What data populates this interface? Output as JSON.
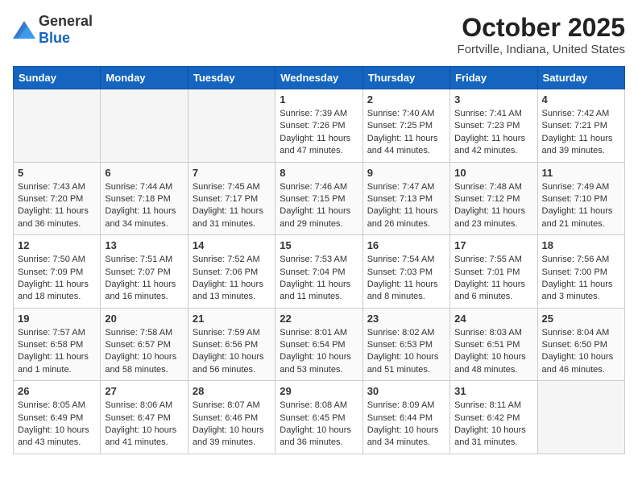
{
  "header": {
    "logo_general": "General",
    "logo_blue": "Blue",
    "month_year": "October 2025",
    "location": "Fortville, Indiana, United States"
  },
  "weekdays": [
    "Sunday",
    "Monday",
    "Tuesday",
    "Wednesday",
    "Thursday",
    "Friday",
    "Saturday"
  ],
  "weeks": [
    [
      {
        "day": "",
        "empty": true
      },
      {
        "day": "",
        "empty": true
      },
      {
        "day": "",
        "empty": true
      },
      {
        "day": "1",
        "sunrise": "7:39 AM",
        "sunset": "7:26 PM",
        "daylight": "11 hours and 47 minutes."
      },
      {
        "day": "2",
        "sunrise": "7:40 AM",
        "sunset": "7:25 PM",
        "daylight": "11 hours and 44 minutes."
      },
      {
        "day": "3",
        "sunrise": "7:41 AM",
        "sunset": "7:23 PM",
        "daylight": "11 hours and 42 minutes."
      },
      {
        "day": "4",
        "sunrise": "7:42 AM",
        "sunset": "7:21 PM",
        "daylight": "11 hours and 39 minutes."
      }
    ],
    [
      {
        "day": "5",
        "sunrise": "7:43 AM",
        "sunset": "7:20 PM",
        "daylight": "11 hours and 36 minutes."
      },
      {
        "day": "6",
        "sunrise": "7:44 AM",
        "sunset": "7:18 PM",
        "daylight": "11 hours and 34 minutes."
      },
      {
        "day": "7",
        "sunrise": "7:45 AM",
        "sunset": "7:17 PM",
        "daylight": "11 hours and 31 minutes."
      },
      {
        "day": "8",
        "sunrise": "7:46 AM",
        "sunset": "7:15 PM",
        "daylight": "11 hours and 29 minutes."
      },
      {
        "day": "9",
        "sunrise": "7:47 AM",
        "sunset": "7:13 PM",
        "daylight": "11 hours and 26 minutes."
      },
      {
        "day": "10",
        "sunrise": "7:48 AM",
        "sunset": "7:12 PM",
        "daylight": "11 hours and 23 minutes."
      },
      {
        "day": "11",
        "sunrise": "7:49 AM",
        "sunset": "7:10 PM",
        "daylight": "11 hours and 21 minutes."
      }
    ],
    [
      {
        "day": "12",
        "sunrise": "7:50 AM",
        "sunset": "7:09 PM",
        "daylight": "11 hours and 18 minutes."
      },
      {
        "day": "13",
        "sunrise": "7:51 AM",
        "sunset": "7:07 PM",
        "daylight": "11 hours and 16 minutes."
      },
      {
        "day": "14",
        "sunrise": "7:52 AM",
        "sunset": "7:06 PM",
        "daylight": "11 hours and 13 minutes."
      },
      {
        "day": "15",
        "sunrise": "7:53 AM",
        "sunset": "7:04 PM",
        "daylight": "11 hours and 11 minutes."
      },
      {
        "day": "16",
        "sunrise": "7:54 AM",
        "sunset": "7:03 PM",
        "daylight": "11 hours and 8 minutes."
      },
      {
        "day": "17",
        "sunrise": "7:55 AM",
        "sunset": "7:01 PM",
        "daylight": "11 hours and 6 minutes."
      },
      {
        "day": "18",
        "sunrise": "7:56 AM",
        "sunset": "7:00 PM",
        "daylight": "11 hours and 3 minutes."
      }
    ],
    [
      {
        "day": "19",
        "sunrise": "7:57 AM",
        "sunset": "6:58 PM",
        "daylight": "11 hours and 1 minute."
      },
      {
        "day": "20",
        "sunrise": "7:58 AM",
        "sunset": "6:57 PM",
        "daylight": "10 hours and 58 minutes."
      },
      {
        "day": "21",
        "sunrise": "7:59 AM",
        "sunset": "6:56 PM",
        "daylight": "10 hours and 56 minutes."
      },
      {
        "day": "22",
        "sunrise": "8:01 AM",
        "sunset": "6:54 PM",
        "daylight": "10 hours and 53 minutes."
      },
      {
        "day": "23",
        "sunrise": "8:02 AM",
        "sunset": "6:53 PM",
        "daylight": "10 hours and 51 minutes."
      },
      {
        "day": "24",
        "sunrise": "8:03 AM",
        "sunset": "6:51 PM",
        "daylight": "10 hours and 48 minutes."
      },
      {
        "day": "25",
        "sunrise": "8:04 AM",
        "sunset": "6:50 PM",
        "daylight": "10 hours and 46 minutes."
      }
    ],
    [
      {
        "day": "26",
        "sunrise": "8:05 AM",
        "sunset": "6:49 PM",
        "daylight": "10 hours and 43 minutes."
      },
      {
        "day": "27",
        "sunrise": "8:06 AM",
        "sunset": "6:47 PM",
        "daylight": "10 hours and 41 minutes."
      },
      {
        "day": "28",
        "sunrise": "8:07 AM",
        "sunset": "6:46 PM",
        "daylight": "10 hours and 39 minutes."
      },
      {
        "day": "29",
        "sunrise": "8:08 AM",
        "sunset": "6:45 PM",
        "daylight": "10 hours and 36 minutes."
      },
      {
        "day": "30",
        "sunrise": "8:09 AM",
        "sunset": "6:44 PM",
        "daylight": "10 hours and 34 minutes."
      },
      {
        "day": "31",
        "sunrise": "8:11 AM",
        "sunset": "6:42 PM",
        "daylight": "10 hours and 31 minutes."
      },
      {
        "day": "",
        "empty": true
      }
    ]
  ]
}
